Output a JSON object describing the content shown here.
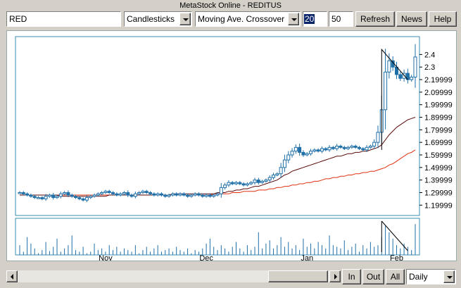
{
  "window": {
    "title": "MetaStock Online - REDITUS"
  },
  "toolbar": {
    "symbol_value": "RED",
    "chart_type_value": "Candlesticks",
    "indicator_value": "Moving Ave. Crossover",
    "period_fast_value": "20",
    "period_slow_value": "50",
    "refresh_label": "Refresh",
    "news_label": "News",
    "help_label": "Help"
  },
  "bottom": {
    "zoom_in_label": "In",
    "zoom_out_label": "Out",
    "all_label": "All",
    "interval_value": "Daily"
  },
  "colors": {
    "candle_outline": "#1f6fa8",
    "ma_fast": "#5a0a0a",
    "ma_slow": "#e03010",
    "volume": "#1f6fa8",
    "frame": "#3a8fb0"
  },
  "chart_data": {
    "type": "candlestick",
    "title": "",
    "xlabel": "",
    "ylabel": "",
    "x_ticks": [
      "Nov",
      "Dec",
      "Jan",
      "Feb"
    ],
    "y_ticks": [
      "2.4",
      "2.3",
      "2.19999",
      "2.09999",
      "1.99999",
      "1.89999",
      "1.79999",
      "1.69999",
      "1.59999",
      "1.49999",
      "1.39999",
      "1.29999",
      "1.19999"
    ],
    "ylim": [
      1.14,
      2.52
    ],
    "closes": [
      1.3,
      1.29,
      1.28,
      1.27,
      1.26,
      1.26,
      1.25,
      1.27,
      1.28,
      1.26,
      1.27,
      1.29,
      1.3,
      1.28,
      1.27,
      1.26,
      1.25,
      1.24,
      1.26,
      1.27,
      1.28,
      1.29,
      1.3,
      1.31,
      1.3,
      1.29,
      1.28,
      1.29,
      1.3,
      1.28,
      1.27,
      1.29,
      1.3,
      1.31,
      1.3,
      1.29,
      1.28,
      1.29,
      1.28,
      1.27,
      1.28,
      1.29,
      1.28,
      1.29,
      1.28,
      1.27,
      1.28,
      1.29,
      1.28,
      1.27,
      1.28,
      1.27,
      1.28,
      1.29,
      1.34,
      1.36,
      1.38,
      1.37,
      1.38,
      1.37,
      1.36,
      1.37,
      1.38,
      1.4,
      1.38,
      1.39,
      1.4,
      1.42,
      1.44,
      1.45,
      1.5,
      1.56,
      1.6,
      1.63,
      1.66,
      1.62,
      1.6,
      1.61,
      1.63,
      1.64,
      1.63,
      1.65,
      1.64,
      1.66,
      1.65,
      1.67,
      1.66,
      1.65,
      1.66,
      1.67,
      1.66,
      1.65,
      1.64,
      1.66,
      1.67,
      1.7,
      1.78,
      1.96,
      2.26,
      2.35,
      2.3,
      2.24,
      2.21,
      2.25,
      2.2,
      2.22,
      2.38
    ],
    "ma_fast": [
      1.28,
      1.28,
      1.28,
      1.28,
      1.28,
      1.28,
      1.28,
      1.28,
      1.28,
      1.28,
      1.28,
      1.27,
      1.27,
      1.27,
      1.27,
      1.27,
      1.27,
      1.27,
      1.27,
      1.27,
      1.27,
      1.27,
      1.27,
      1.27,
      1.28,
      1.28,
      1.28,
      1.28,
      1.28,
      1.28,
      1.28,
      1.28,
      1.28,
      1.28,
      1.28,
      1.28,
      1.28,
      1.28,
      1.28,
      1.28,
      1.28,
      1.29,
      1.29,
      1.29,
      1.29,
      1.29,
      1.29,
      1.29,
      1.29,
      1.29,
      1.29,
      1.29,
      1.29,
      1.3,
      1.3,
      1.3,
      1.31,
      1.31,
      1.32,
      1.32,
      1.33,
      1.33,
      1.34,
      1.35,
      1.35,
      1.36,
      1.37,
      1.38,
      1.39,
      1.4,
      1.42,
      1.44,
      1.45,
      1.47,
      1.48,
      1.49,
      1.5,
      1.51,
      1.52,
      1.53,
      1.54,
      1.55,
      1.56,
      1.57,
      1.58,
      1.59,
      1.59,
      1.6,
      1.61,
      1.61,
      1.62,
      1.62,
      1.63,
      1.63,
      1.64,
      1.65,
      1.66,
      1.68,
      1.72,
      1.76,
      1.79,
      1.82,
      1.84,
      1.86,
      1.88,
      1.89,
      1.9
    ],
    "ma_slow": [
      1.28,
      1.28,
      1.28,
      1.28,
      1.28,
      1.28,
      1.28,
      1.28,
      1.28,
      1.28,
      1.28,
      1.28,
      1.28,
      1.28,
      1.28,
      1.28,
      1.28,
      1.28,
      1.28,
      1.28,
      1.28,
      1.28,
      1.28,
      1.28,
      1.28,
      1.28,
      1.28,
      1.28,
      1.28,
      1.28,
      1.28,
      1.28,
      1.28,
      1.28,
      1.28,
      1.28,
      1.28,
      1.28,
      1.28,
      1.28,
      1.28,
      1.28,
      1.28,
      1.28,
      1.28,
      1.28,
      1.28,
      1.28,
      1.28,
      1.28,
      1.28,
      1.28,
      1.29,
      1.29,
      1.29,
      1.29,
      1.29,
      1.3,
      1.3,
      1.3,
      1.31,
      1.31,
      1.31,
      1.31,
      1.32,
      1.32,
      1.32,
      1.33,
      1.33,
      1.34,
      1.34,
      1.35,
      1.35,
      1.36,
      1.36,
      1.37,
      1.37,
      1.38,
      1.38,
      1.39,
      1.39,
      1.4,
      1.41,
      1.41,
      1.42,
      1.42,
      1.43,
      1.43,
      1.44,
      1.44,
      1.45,
      1.45,
      1.46,
      1.46,
      1.47,
      1.47,
      1.48,
      1.49,
      1.5,
      1.52,
      1.53,
      1.55,
      1.57,
      1.59,
      1.61,
      1.62,
      1.64
    ],
    "volume": [
      0.3,
      0.1,
      0.55,
      0.35,
      0.2,
      0.05,
      0.15,
      0.4,
      0.12,
      0.25,
      0.5,
      0.1,
      0.2,
      0.3,
      0.6,
      0.15,
      0.1,
      0.25,
      0.05,
      0.1,
      0.35,
      0.15,
      0.2,
      0.1,
      0.3,
      0.15,
      0.25,
      0.1,
      0.2,
      0.15,
      0.1,
      0.3,
      0.05,
      0.15,
      0.25,
      0.1,
      0.2,
      0.3,
      0.1,
      0.15,
      0.2,
      0.1,
      0.25,
      0.15,
      0.1,
      0.2,
      0.05,
      0.15,
      0.1,
      0.2,
      0.35,
      0.5,
      0.25,
      0.15,
      0.3,
      0.2,
      0.1,
      0.25,
      0.4,
      0.2,
      0.1,
      0.3,
      0.15,
      0.25,
      0.7,
      0.2,
      0.35,
      0.45,
      0.2,
      0.3,
      0.55,
      0.25,
      0.4,
      0.2,
      0.3,
      0.15,
      0.5,
      0.25,
      0.35,
      0.2,
      0.4,
      0.3,
      0.2,
      0.6,
      0.3,
      0.25,
      0.2,
      0.45,
      0.15,
      0.25,
      0.35,
      0.1,
      0.3,
      0.2,
      0.4,
      0.25,
      0.3,
      0.55,
      0.9,
      0.7,
      0.5,
      0.3,
      0.2,
      0.35,
      0.25,
      0.15,
      0.95
    ]
  }
}
